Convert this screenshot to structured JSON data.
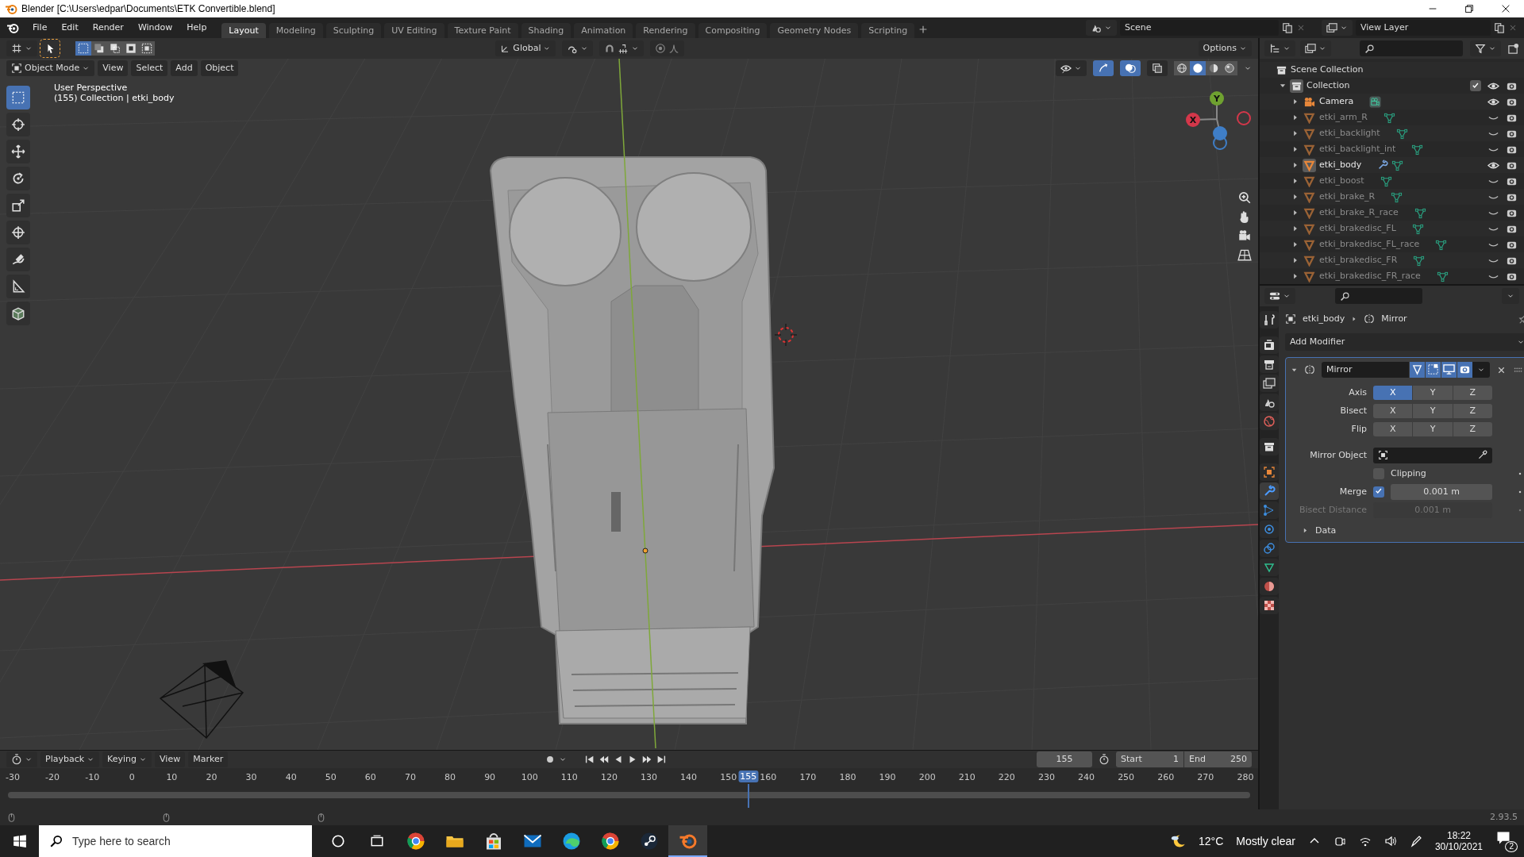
{
  "title_bar": {
    "title": "Blender [C:\\Users\\edpar\\Documents\\ETK Convertible.blend]"
  },
  "menu": [
    "File",
    "Edit",
    "Render",
    "Window",
    "Help"
  ],
  "workspaces": [
    {
      "label": "Layout",
      "selected": true
    },
    {
      "label": "Modeling",
      "selected": false
    },
    {
      "label": "Sculpting",
      "selected": false
    },
    {
      "label": "UV Editing",
      "selected": false
    },
    {
      "label": "Texture Paint",
      "selected": false
    },
    {
      "label": "Shading",
      "selected": false
    },
    {
      "label": "Animation",
      "selected": false
    },
    {
      "label": "Rendering",
      "selected": false
    },
    {
      "label": "Compositing",
      "selected": false
    },
    {
      "label": "Geometry Nodes",
      "selected": false
    },
    {
      "label": "Scripting",
      "selected": false
    }
  ],
  "scene": "Scene",
  "view_layer": "View Layer",
  "viewport": {
    "transform_orientation": "Global",
    "options": "Options",
    "mode": "Object Mode",
    "menus": [
      "View",
      "Select",
      "Add",
      "Object"
    ],
    "info": [
      "User Perspective",
      "(155) Collection | etki_body"
    ],
    "shading": [
      {
        "kind": "wireframe",
        "selected": false
      },
      {
        "kind": "solid",
        "selected": true
      },
      {
        "kind": "material",
        "selected": false
      },
      {
        "kind": "rendered",
        "selected": false
      }
    ],
    "gizmo_axes": [
      "Y",
      "X"
    ]
  },
  "outliner": {
    "root": "Scene Collection",
    "collection": {
      "label": "Collection",
      "expanded": true,
      "checked": true,
      "children": [
        {
          "label": "Camera",
          "kind": "camera",
          "visible": true,
          "selected": false,
          "modifier": false
        },
        {
          "label": "etki_arm_R",
          "kind": "mesh",
          "visible": false,
          "selected": false,
          "modifier": false
        },
        {
          "label": "etki_backlight",
          "kind": "mesh",
          "visible": false,
          "selected": false,
          "modifier": false
        },
        {
          "label": "etki_backlight_int",
          "kind": "mesh",
          "visible": false,
          "selected": false,
          "modifier": false
        },
        {
          "label": "etki_body",
          "kind": "mesh",
          "visible": true,
          "selected": true,
          "modifier": true
        },
        {
          "label": "etki_boost",
          "kind": "mesh",
          "visible": false,
          "selected": false,
          "modifier": false
        },
        {
          "label": "etki_brake_R",
          "kind": "mesh",
          "visible": false,
          "selected": false,
          "modifier": false
        },
        {
          "label": "etki_brake_R_race",
          "kind": "mesh",
          "visible": false,
          "selected": false,
          "modifier": false
        },
        {
          "label": "etki_brakedisc_FL",
          "kind": "mesh",
          "visible": false,
          "selected": false,
          "modifier": false
        },
        {
          "label": "etki_brakedisc_FL_race",
          "kind": "mesh",
          "visible": false,
          "selected": false,
          "modifier": false
        },
        {
          "label": "etki_brakedisc_FR",
          "kind": "mesh",
          "visible": false,
          "selected": false,
          "modifier": false
        },
        {
          "label": "etki_brakedisc_FR_race",
          "kind": "mesh",
          "visible": false,
          "selected": false,
          "modifier": false
        }
      ]
    }
  },
  "properties": {
    "tabs": [
      {
        "kind": "tool",
        "selected": false
      },
      {
        "kind": "render",
        "selected": false
      },
      {
        "kind": "output",
        "selected": false
      },
      {
        "kind": "view_layer",
        "selected": false
      },
      {
        "kind": "scene",
        "selected": false
      },
      {
        "kind": "world",
        "selected": false
      },
      {
        "kind": "collection",
        "selected": false
      },
      {
        "kind": "object",
        "selected": false
      },
      {
        "kind": "modifiers",
        "selected": true
      },
      {
        "kind": "particles",
        "selected": false
      },
      {
        "kind": "physics",
        "selected": false
      },
      {
        "kind": "constraints",
        "selected": false
      },
      {
        "kind": "data",
        "selected": false
      },
      {
        "kind": "material",
        "selected": false
      },
      {
        "kind": "texture",
        "selected": false
      }
    ],
    "object": "etki_body",
    "context": "Mirror",
    "add_modifier": "Add Modifier",
    "modifier": {
      "name": "Mirror",
      "expanded": true,
      "toggles": [
        {
          "kind": "editmode",
          "on": true
        },
        {
          "kind": "cage",
          "on": true
        },
        {
          "kind": "viewport",
          "on": true
        },
        {
          "kind": "render",
          "on": true
        }
      ],
      "axis_rows": [
        {
          "label": "Axis",
          "buttons": [
            {
              "label": "X",
              "on": true
            },
            {
              "label": "Y",
              "on": false
            },
            {
              "label": "Z",
              "on": false
            }
          ]
        },
        {
          "label": "Bisect",
          "buttons": [
            {
              "label": "X",
              "on": false
            },
            {
              "label": "Y",
              "on": false
            },
            {
              "label": "Z",
              "on": false
            }
          ]
        },
        {
          "label": "Flip",
          "buttons": [
            {
              "label": "X",
              "on": false
            },
            {
              "label": "Y",
              "on": false
            },
            {
              "label": "Z",
              "on": false
            }
          ]
        }
      ],
      "mirror_object": {
        "label": "Mirror Object"
      },
      "clipping": {
        "label": "Clipping",
        "checked": false
      },
      "merge": {
        "label": "Merge",
        "checked": true,
        "value": "0.001 m"
      },
      "bisect_distance": {
        "label": "Bisect Distance",
        "value": "0.001 m",
        "disabled": true
      },
      "subpanels": [
        {
          "label": "Data",
          "expanded": false
        }
      ]
    }
  },
  "timeline": {
    "menus": [
      "Playback",
      "Keying",
      "View",
      "Marker"
    ],
    "current_frame": "155",
    "start_label": "Start",
    "start": "1",
    "end_label": "End",
    "end": "250",
    "ruler": [
      "-30",
      "-20",
      "-10",
      "0",
      "10",
      "20",
      "30",
      "40",
      "50",
      "60",
      "70",
      "80",
      "90",
      "100",
      "110",
      "120",
      "130",
      "140",
      "150",
      "160",
      "170",
      "180",
      "190",
      "200",
      "210",
      "220",
      "230",
      "240",
      "250",
      "260",
      "270",
      "280"
    ],
    "playhead": "155"
  },
  "status_bar": {
    "version": "2.93.5"
  },
  "taskbar": {
    "search_placeholder": "Type here to search",
    "apps": [
      {
        "kind": "globe",
        "active": false
      },
      {
        "kind": "folder",
        "active": false
      },
      {
        "kind": "bag",
        "active": false
      },
      {
        "kind": "mail",
        "active": false
      },
      {
        "kind": "wave",
        "active": false
      },
      {
        "kind": "globe",
        "active": false
      },
      {
        "kind": "disc",
        "active": false
      },
      {
        "kind": "orbit",
        "active": true
      }
    ],
    "weather": {
      "temperature": "12°C",
      "condition": "Mostly clear"
    },
    "time": "18:22",
    "date": "30/10/2021",
    "notifications": "2"
  }
}
